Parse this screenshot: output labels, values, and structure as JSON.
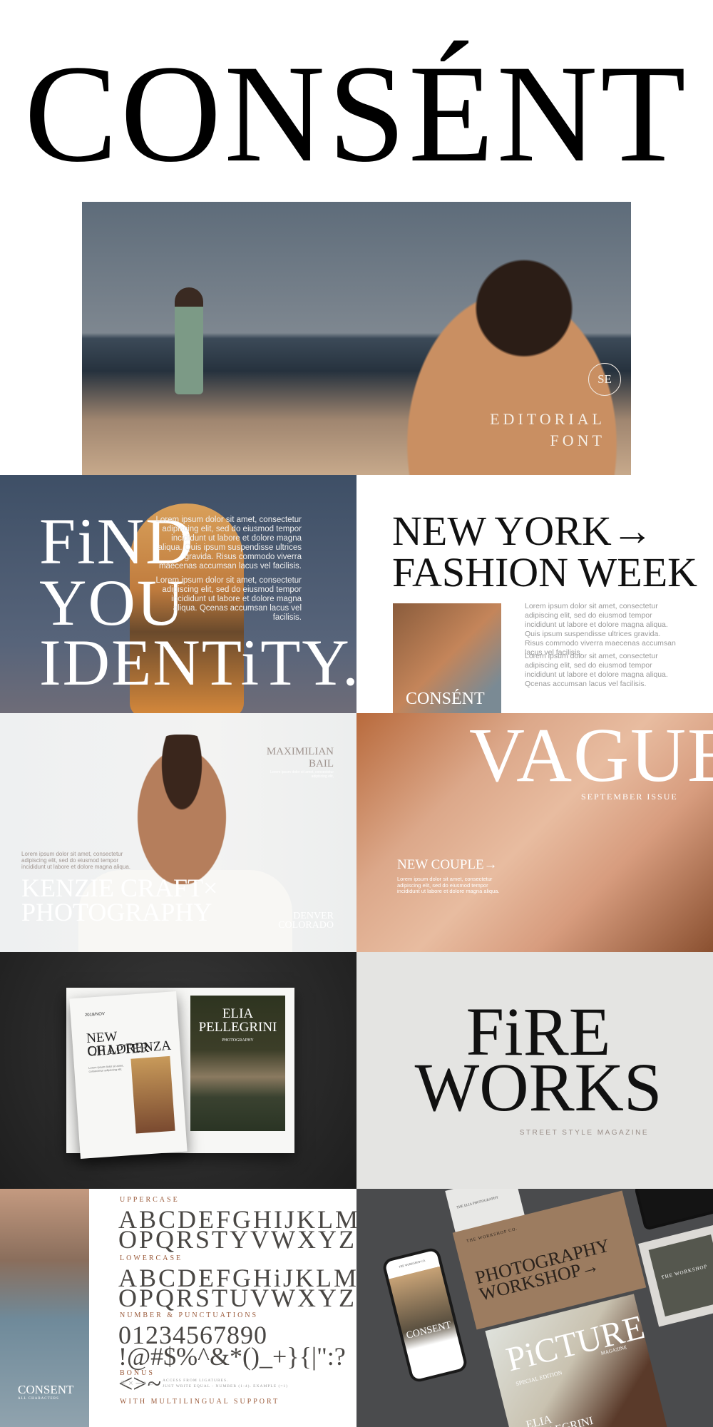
{
  "logo": "CONSÉNT",
  "hero": {
    "badge": "SE",
    "line1": "EDITORIAL",
    "line2": "FONT"
  },
  "find": {
    "line1": "FiND",
    "line2": "YOU",
    "line3": "IDENTiTY.",
    "para1": "Lorem ipsum dolor sit amet, consectetur adipiscing elit, sed do eiusmod tempor incididunt ut labore et dolore magna aliqua. Quis ipsum suspendisse ultrices gravida. Risus commodo viverra maecenas accumsan lacus vel facilisis.",
    "para2": "Lorem ipsum dolor sit amet, consectetur adipiscing elit, sed do eiusmod tempor incididunt ut labore et dolore magna aliqua. Qcenas accumsan lacus vel facilisis."
  },
  "newyork": {
    "line1": "NEW YORK→",
    "line2": "FASHION WEEK",
    "image_logo": "CONSÉNT",
    "para1": "Lorem ipsum dolor sit amet, consectetur adipiscing elit, sed do eiusmod tempor incididunt ut labore et dolore magna aliqua. Quis ipsum suspendisse ultrices gravida. Risus commodo viverra maecenas accumsan lacus vel facilisis.",
    "para2": "Lorem ipsum dolor sit amet, consectetur adipiscing elit, sed do eiusmod tempor incididunt ut labore et dolore magna aliqua. Qcenas accumsan lacus vel facilisis."
  },
  "kenzie": {
    "name1": "MAXIMILIAN",
    "name2": "BAIL",
    "name_sub": "Lorem ipsum dolor sit amet, consectetur adipiscing elit,",
    "para": "Lorem ipsum dolor sit amet, consectetur adipiscing elit, sed do eiusmod tempor incididunt ut labore et dolore magna aliqua.",
    "title1": "KENZIE CRAFT×",
    "title2": "PHOTOGRAPHY",
    "loc1": "DENVER",
    "loc2": "COLORADO"
  },
  "vague": {
    "title": "VAGUE",
    "issue": "SEPTEMBER ISSUE",
    "headline": "NEW COUPLE→",
    "para": "Lorem ipsum dolor sit amet, consectetur adipiscing elit, sed do eiusmod tempor incididunt ut labore et dolore magna aliqua."
  },
  "book": {
    "date": "2018/NOV",
    "left_title1": "NEW CHAPTER",
    "left_title2": "OF LORENZA",
    "left_sub": "Lorem ipsum dolor sit amet, consectetur adipiscing elit.",
    "right_title1": "ELIA",
    "right_title2": "PELLEGRINI",
    "right_sub": "PHOTOGRAPHY"
  },
  "fireworks": {
    "line1": "FiRE",
    "line2": "WORKS",
    "sub": "STREET STYLE MAGAZINE"
  },
  "specimen": {
    "strip_logo": "CONSENT",
    "strip_sub": "ALL CHARACTERS",
    "upper_label": "UPPERCASE",
    "upper1": "ABCDEFGHIJKLMN",
    "upper2": "OPQRSTYVWXYZ",
    "lower_label": "LOWERCASE",
    "lower1": "ABCDEFGHiJKLMN",
    "lower2": "OPQRSTUVWXYZ",
    "num_label": "NUMBER & PUNCTUATIONS",
    "nums": "01234567890",
    "punct": "!@#$%^&*()_+}{|\":?<>~",
    "bonus_label": "BONUS",
    "bonus_glyphs": "✳ × ⟶ ○",
    "bonus_text1": "ACCESS FROM LIGATURES.",
    "bonus_text2": "JUST WRITE EQUAL - NUMBER (1-4). EXAMPLE (=1)",
    "multi": "WITH MULTILINGUAL SUPPORT"
  },
  "mockups": {
    "card_top": "THE ELIA PHOTOGRAPHY",
    "kraft_company": "THE WORKSHOP CO.",
    "kraft_title1": "PHOTOGRAPHY",
    "kraft_title2": "WORKSHOP→",
    "phone_header": "THE WORKSHOP CO.",
    "phone_logo": "CONSENT",
    "card_right": "THE WORKSHOP",
    "mag_title": "PiCTURE",
    "mag_tag": "MAGAZINE",
    "mag_edition": "SPECIAL EDITION",
    "mag_name1": "ELIA",
    "mag_name2": "PELLEGRINI"
  }
}
